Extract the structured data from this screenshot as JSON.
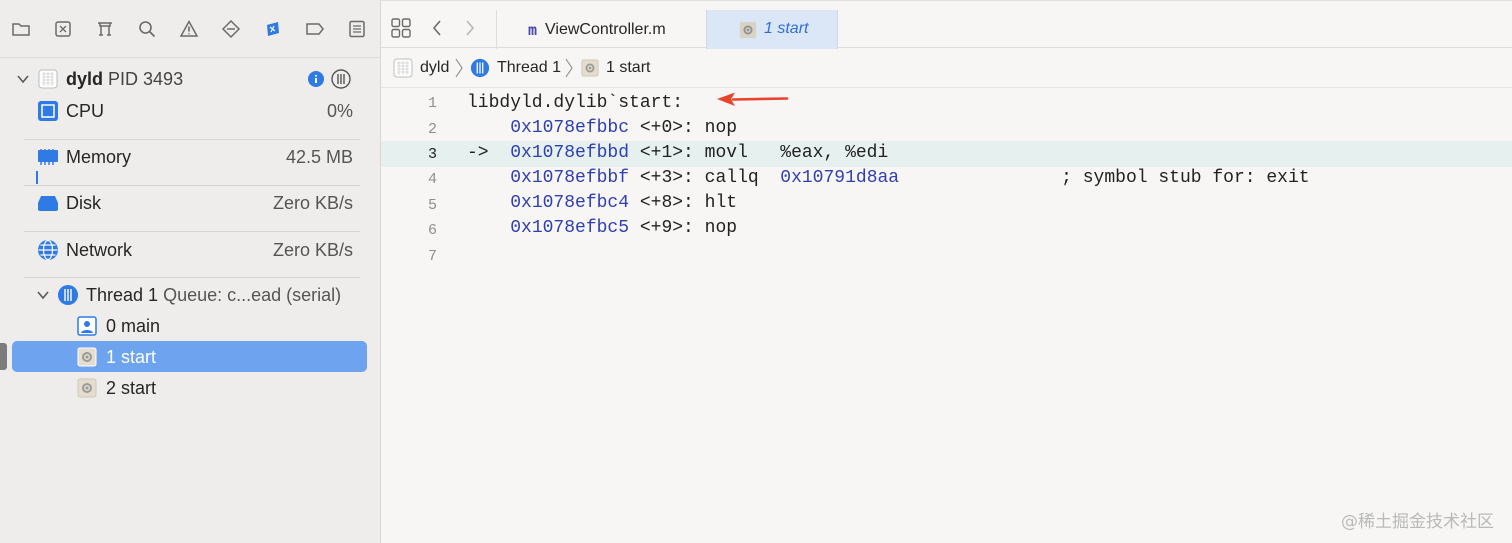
{
  "navigator": {
    "toolbar_icons": [
      "folder-icon",
      "source-control-icon",
      "symbol-icon",
      "find-icon",
      "issue-icon",
      "test-icon",
      "debug-icon",
      "breakpoint-icon",
      "report-icon"
    ],
    "process": {
      "name": "dyld",
      "pid_label": "PID 3493"
    },
    "gauges": [
      {
        "label": "CPU",
        "value": "0%"
      },
      {
        "label": "Memory",
        "value": "42.5 MB"
      },
      {
        "label": "Disk",
        "value": "Zero KB/s"
      },
      {
        "label": "Network",
        "value": "Zero KB/s"
      }
    ],
    "thread": {
      "name": "Thread 1",
      "queue": "Queue: c...ead (serial)"
    },
    "frames": [
      {
        "label": "0 main",
        "selected": false
      },
      {
        "label": "1 start",
        "selected": true
      },
      {
        "label": "2 start",
        "selected": false
      }
    ]
  },
  "editor": {
    "tabs": [
      {
        "label": "ViewController.m",
        "active": false
      },
      {
        "label": "1 start",
        "active": true
      }
    ],
    "jumpbar": [
      "dyld",
      "Thread 1",
      "1 start"
    ],
    "lines": [
      {
        "num": "1",
        "text": "libdyld.dylib`start:"
      },
      {
        "num": "2",
        "prefix": "    ",
        "addr": "0x1078efbbc",
        "rest": " <+0>: nop"
      },
      {
        "num": "3",
        "prefix": "->  ",
        "addr": "0x1078efbbd",
        "rest": " <+1>: movl   %eax, %edi"
      },
      {
        "num": "4",
        "prefix": "    ",
        "addr": "0x1078efbbf",
        "rest": " <+3>: callq  ",
        "addr2": "0x10791d8aa",
        "comment": "               ; symbol stub for: exit"
      },
      {
        "num": "5",
        "prefix": "    ",
        "addr": "0x1078efbc4",
        "rest": " <+8>: hlt"
      },
      {
        "num": "6",
        "prefix": "    ",
        "addr": "0x1078efbc5",
        "rest": " <+9>: nop"
      },
      {
        "num": "7",
        "text": ""
      }
    ],
    "current_line": "3",
    "annotation_arrow_color": "#e8432d"
  },
  "watermark": "@稀土掘金技术社区"
}
